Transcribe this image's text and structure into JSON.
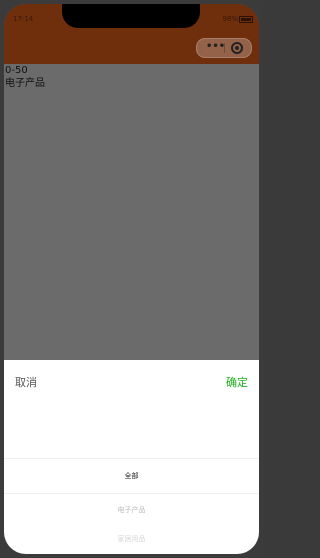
{
  "status_bar": {
    "time": "17:14",
    "battery_percent": "98%"
  },
  "nav_bar": {
    "capsule_menu_icon": "more-dots-icon",
    "capsule_close_icon": "target-icon"
  },
  "content": {
    "price_range": "0-50",
    "category": "电子产品"
  },
  "picker": {
    "cancel_label": "取消",
    "confirm_label": "确定",
    "confirm_color": "#1aad19",
    "options": [
      "全部",
      "电子产品",
      "家居用品"
    ],
    "selected_index": 0
  },
  "colors": {
    "nav_background": "#6f2e0c",
    "overlay": "#6b6b6b"
  }
}
